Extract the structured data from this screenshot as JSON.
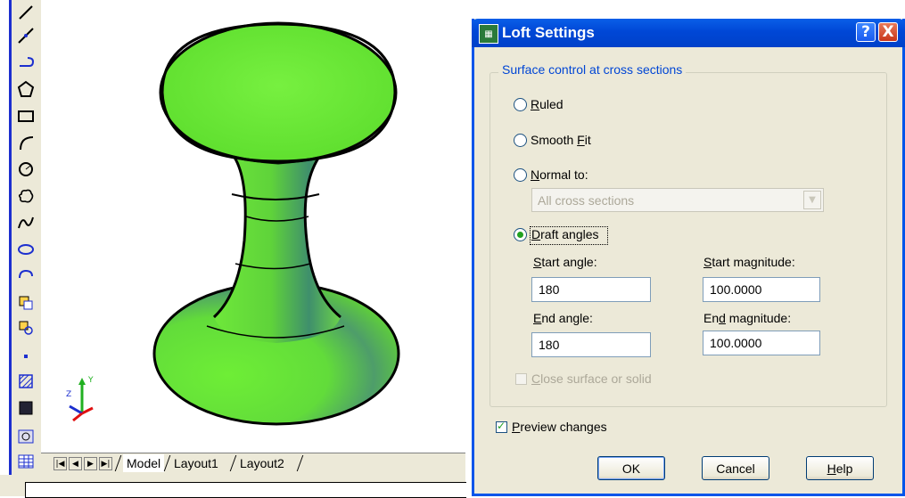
{
  "cad": {
    "tabs": {
      "model": "Model",
      "layout1": "Layout1",
      "layout2": "Layout2"
    },
    "ucs": {
      "x_label": "",
      "y_label": "Y",
      "z_label": "Z"
    },
    "model_color": "#66ee33"
  },
  "dialog": {
    "title": "Loft Settings",
    "help_icon": "?",
    "close_icon": "X",
    "group_title": "Surface control at cross sections",
    "options": {
      "ruled": {
        "mnemonic": "R",
        "rest": "uled"
      },
      "smooth": {
        "prefix": "Smooth ",
        "mnemonic": "F",
        "rest": "it"
      },
      "normal": {
        "mnemonic": "N",
        "rest": "ormal to:"
      },
      "draft": {
        "mnemonic": "D",
        "rest": "raft angles"
      }
    },
    "normal_to_select": "All cross sections",
    "start_angle": {
      "mnemonic": "S",
      "rest": "tart angle:",
      "value": "180"
    },
    "start_magnitude": {
      "mnemonic": "S",
      "rest": "tart magnitude:",
      "value": "100.0000"
    },
    "end_angle": {
      "mnemonic": "E",
      "rest": "nd angle:",
      "value": "180"
    },
    "end_magnitude": {
      "prefix": "En",
      "mnemonic": "d",
      "rest": " magnitude:",
      "value": "100.0000"
    },
    "close_surface": {
      "mnemonic": "C",
      "rest": "lose surface or solid"
    },
    "preview_changes": {
      "mnemonic": "P",
      "rest": "review changes",
      "checked": true
    },
    "buttons": {
      "ok": "OK",
      "cancel": "Cancel",
      "help_mnemonic": "H",
      "help_rest": "elp"
    }
  }
}
